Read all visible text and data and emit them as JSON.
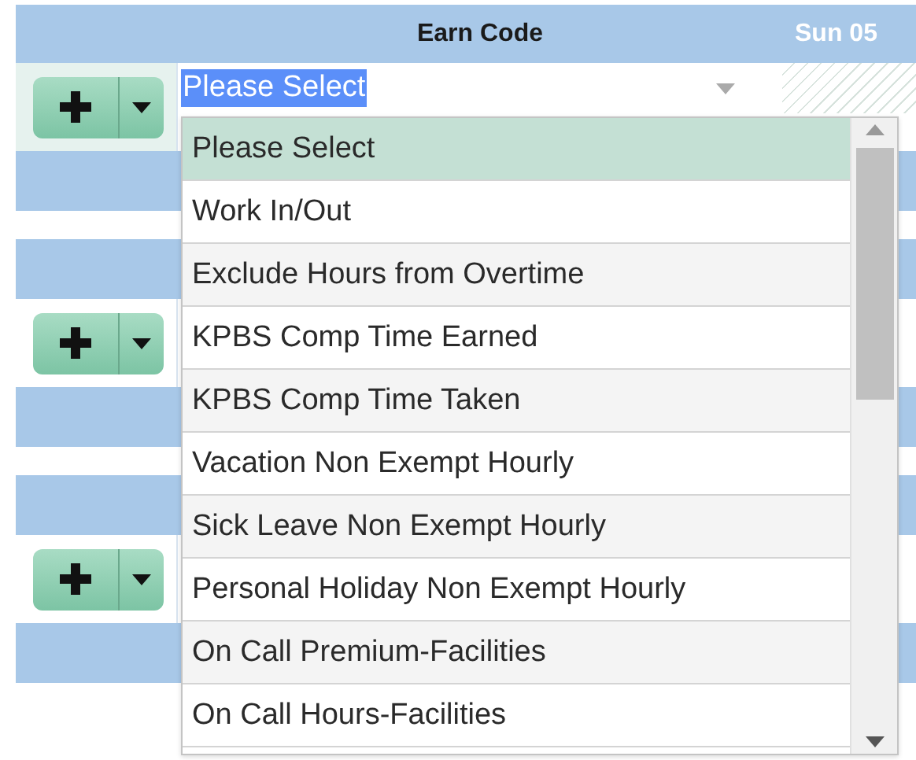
{
  "header": {
    "columns": [
      "Earn Code",
      "Sun 05"
    ]
  },
  "rows": [
    {
      "earn_code": {
        "value": "Please Select",
        "focused": true
      },
      "hatched": true
    },
    {
      "hatched": false
    },
    {
      "hatched": false
    }
  ],
  "dropdown": {
    "options": [
      {
        "label": "Please Select",
        "selected": true
      },
      {
        "label": "Work In/Out",
        "selected": false
      },
      {
        "label": "Exclude Hours from Overtime",
        "selected": false
      },
      {
        "label": "KPBS Comp Time Earned",
        "selected": false
      },
      {
        "label": "KPBS Comp Time Taken",
        "selected": false
      },
      {
        "label": "Vacation Non Exempt Hourly",
        "selected": false
      },
      {
        "label": "Sick Leave Non Exempt Hourly",
        "selected": false
      },
      {
        "label": "Personal Holiday Non Exempt Hourly",
        "selected": false
      },
      {
        "label": "On Call Premium-Facilities",
        "selected": false
      },
      {
        "label": "On Call Hours-Facilities",
        "selected": false
      }
    ]
  }
}
